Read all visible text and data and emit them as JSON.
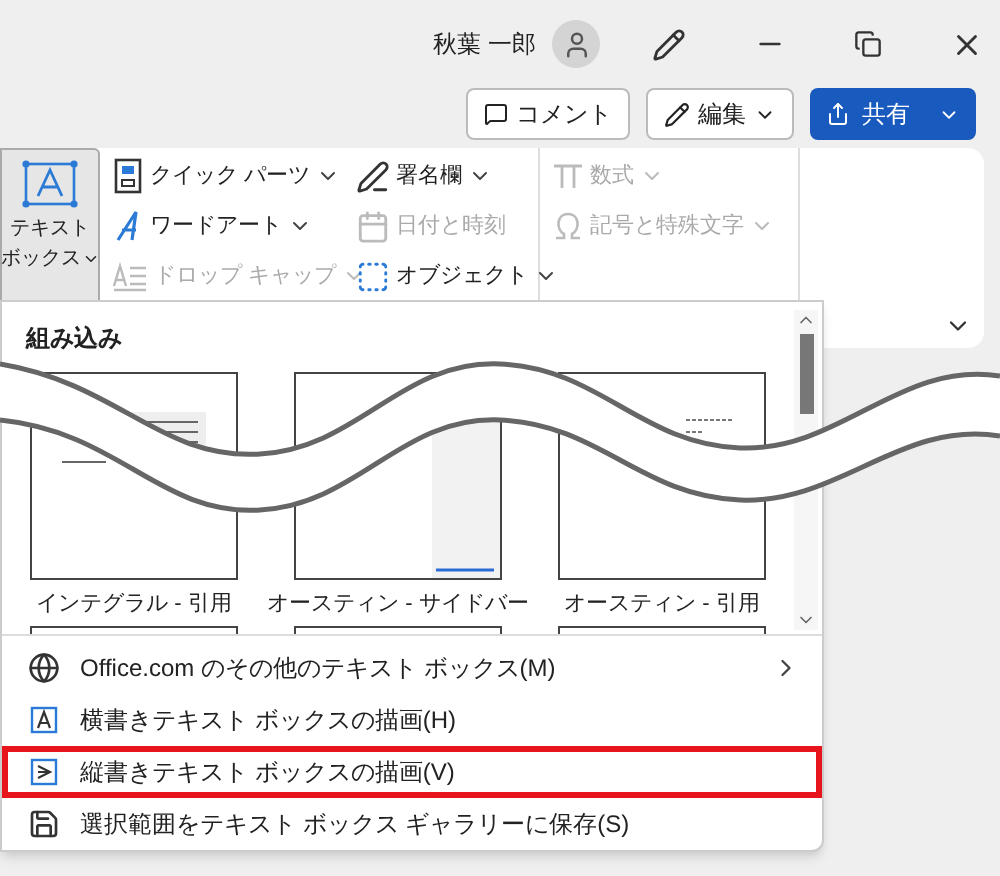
{
  "title_bar": {
    "user_name": "秋葉 一郎"
  },
  "actions": {
    "comment": "コメント",
    "edit": "編集",
    "share": "共有"
  },
  "ribbon": {
    "text_box": {
      "label_line1": "テキスト",
      "label_line2": "ボックス",
      "selected": true
    },
    "columns": [
      [
        {
          "kind": "quickparts",
          "label": "クイック パーツ",
          "dropdown": true,
          "disabled": false
        },
        {
          "kind": "wordart",
          "label": "ワードアート",
          "dropdown": true,
          "disabled": false
        },
        {
          "kind": "dropcap",
          "label": "ドロップ キャップ",
          "dropdown": true,
          "disabled": true
        }
      ],
      [
        {
          "kind": "signature",
          "label": "署名欄",
          "dropdown": true,
          "disabled": false
        },
        {
          "kind": "date",
          "label": "日付と時刻",
          "dropdown": false,
          "disabled": true
        },
        {
          "kind": "object",
          "label": "オブジェクト",
          "dropdown": true,
          "disabled": false
        }
      ],
      [
        {
          "kind": "equation",
          "label": "数式",
          "dropdown": true,
          "disabled": true
        },
        {
          "kind": "symbol",
          "label": "記号と特殊文字",
          "dropdown": true,
          "disabled": true
        }
      ]
    ]
  },
  "menu": {
    "section": "組み込み",
    "gallery": [
      {
        "kind": "integral",
        "label": "インテグラル - 引用"
      },
      {
        "kind": "sidebar",
        "label": "オースティン - サイドバー"
      },
      {
        "kind": "quote",
        "label": "オースティン - 引用"
      }
    ],
    "items": [
      {
        "kind": "globe",
        "label": "Office.com のその他のテキスト ボックス(M)",
        "submenu": true,
        "highlighted": false
      },
      {
        "kind": "horizontal",
        "label": "横書きテキスト ボックスの描画(H)",
        "submenu": false,
        "highlighted": false
      },
      {
        "kind": "vertical",
        "label": "縦書きテキスト ボックスの描画(V)",
        "submenu": false,
        "highlighted": true
      },
      {
        "kind": "save",
        "label": "選択範囲をテキスト ボックス ギャラリーに保存(S)",
        "submenu": false,
        "highlighted": false
      }
    ]
  }
}
